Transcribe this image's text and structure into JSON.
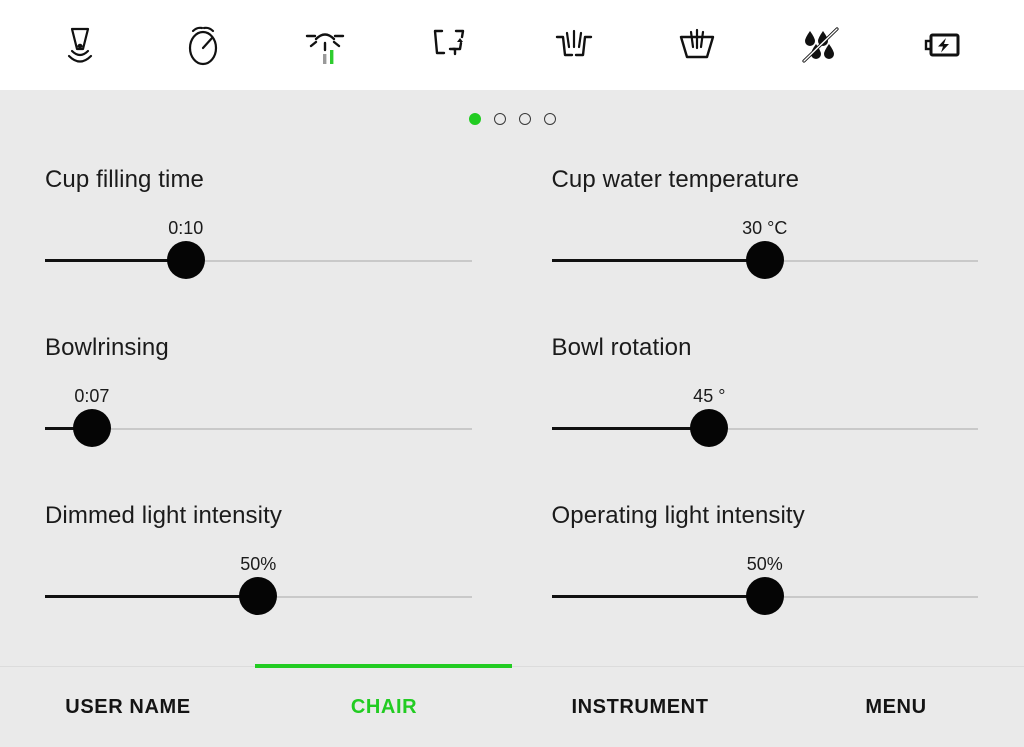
{
  "topbar": {
    "icons": [
      {
        "name": "handpiece-ultrasonic-icon",
        "label": "Ultrasonic scaler"
      },
      {
        "name": "timer-icon",
        "label": "Timer"
      },
      {
        "name": "operating-light-icon",
        "label": "Operating light"
      },
      {
        "name": "chair-position-icon",
        "label": "Chair position"
      },
      {
        "name": "bowl-rinsing-icon",
        "label": "Bowl rinsing"
      },
      {
        "name": "cup-filling-icon",
        "label": "Cup filling"
      },
      {
        "name": "water-off-icon",
        "label": "Water off"
      },
      {
        "name": "battery-charging-icon",
        "label": "Battery charging"
      }
    ]
  },
  "pager": {
    "count": 4,
    "active_index": 0,
    "active_color": "#22cc22",
    "inactive_color": "#3a3a3a"
  },
  "sliders": [
    {
      "name": "cup-filling-time",
      "label": "Cup filling time",
      "value": "0:10",
      "percent": 33
    },
    {
      "name": "cup-water-temperature",
      "label": "Cup water temperature",
      "value": "30 °C",
      "percent": 50
    },
    {
      "name": "bowl-rinsing",
      "label": "Bowlrinsing",
      "value": "0:07",
      "percent": 11
    },
    {
      "name": "bowl-rotation",
      "label": "Bowl rotation",
      "value": "45 °",
      "percent": 37
    },
    {
      "name": "dimmed-light-intensity",
      "label": "Dimmed light intensity",
      "value": "50%",
      "percent": 50
    },
    {
      "name": "operating-light-intensity",
      "label": "Operating light intensity",
      "value": "50%",
      "percent": 50
    }
  ],
  "tabbar": {
    "tabs": [
      {
        "name": "tab-user-name",
        "label": "USER NAME",
        "active": false
      },
      {
        "name": "tab-chair",
        "label": "CHAIR",
        "active": true
      },
      {
        "name": "tab-instrument",
        "label": "INSTRUMENT",
        "active": false
      },
      {
        "name": "tab-menu",
        "label": "MENU",
        "active": false
      }
    ],
    "active_color": "#22cc22"
  }
}
